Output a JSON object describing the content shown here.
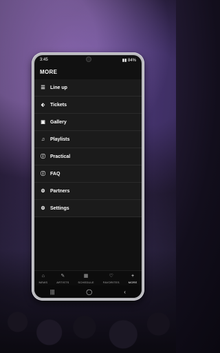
{
  "status": {
    "time": "3:45",
    "battery": "84%"
  },
  "header": {
    "title": "MORE"
  },
  "menu": {
    "items": [
      {
        "label": "Line up",
        "icon": "list-icon"
      },
      {
        "label": "Tickets",
        "icon": "ticket-icon"
      },
      {
        "label": "Gallery",
        "icon": "image-icon"
      },
      {
        "label": "Playlists",
        "icon": "music-note-icon"
      },
      {
        "label": "Practical",
        "icon": "info-icon"
      },
      {
        "label": "FAQ",
        "icon": "info-icon"
      },
      {
        "label": "Partners",
        "icon": "gear-icon"
      },
      {
        "label": "Settings",
        "icon": "gear-icon"
      }
    ]
  },
  "bottom_nav": {
    "items": [
      {
        "label": "NEWS",
        "icon": "home-icon"
      },
      {
        "label": "ARTISTS",
        "icon": "pencil-icon"
      },
      {
        "label": "SCHEDULE",
        "icon": "grid-icon"
      },
      {
        "label": "FAVORITES",
        "icon": "heart-icon"
      },
      {
        "label": "MORE",
        "icon": "plus-icon",
        "active": true
      }
    ]
  }
}
